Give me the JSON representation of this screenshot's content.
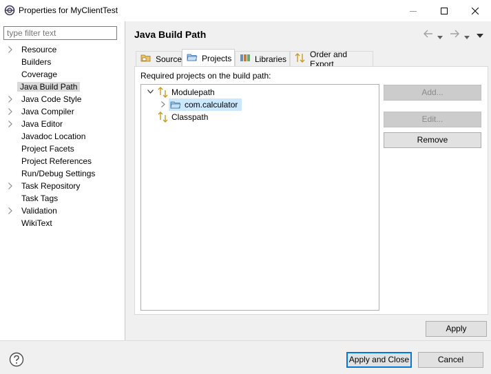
{
  "window": {
    "title": "Properties for MyClientTest",
    "controls": [
      "minimize-icon",
      "maximize-icon",
      "close-icon"
    ]
  },
  "sidebar": {
    "filter_placeholder": "type filter text",
    "items": [
      {
        "label": "Resource",
        "expandable": true
      },
      {
        "label": "Builders",
        "expandable": false
      },
      {
        "label": "Coverage",
        "expandable": false
      },
      {
        "label": "Java Build Path",
        "expandable": false,
        "selected": true
      },
      {
        "label": "Java Code Style",
        "expandable": true
      },
      {
        "label": "Java Compiler",
        "expandable": true
      },
      {
        "label": "Java Editor",
        "expandable": true
      },
      {
        "label": "Javadoc Location",
        "expandable": false
      },
      {
        "label": "Project Facets",
        "expandable": false
      },
      {
        "label": "Project References",
        "expandable": false
      },
      {
        "label": "Run/Debug Settings",
        "expandable": false
      },
      {
        "label": "Task Repository",
        "expandable": true
      },
      {
        "label": "Task Tags",
        "expandable": false
      },
      {
        "label": "Validation",
        "expandable": true
      },
      {
        "label": "WikiText",
        "expandable": false
      }
    ]
  },
  "main": {
    "page_title": "Java Build Path",
    "tabs": [
      {
        "label": "Source",
        "icon": "source-folder-icon"
      },
      {
        "label": "Projects",
        "icon": "project-folder-icon",
        "active": true
      },
      {
        "label": "Libraries",
        "icon": "libraries-icon"
      },
      {
        "label": "Order and Export",
        "icon": "order-export-icon"
      }
    ],
    "required_label": "Required projects on the build path:",
    "tree": {
      "modulepath": "Modulepath",
      "project": "com.calculator",
      "classpath": "Classpath"
    },
    "buttons": {
      "add": "Add...",
      "edit": "Edit...",
      "remove": "Remove"
    }
  },
  "footer": {
    "apply": "Apply",
    "apply_close": "Apply and Close",
    "cancel": "Cancel"
  },
  "colors": {
    "selection": "#cce8ff",
    "accent": "#0078d7"
  }
}
